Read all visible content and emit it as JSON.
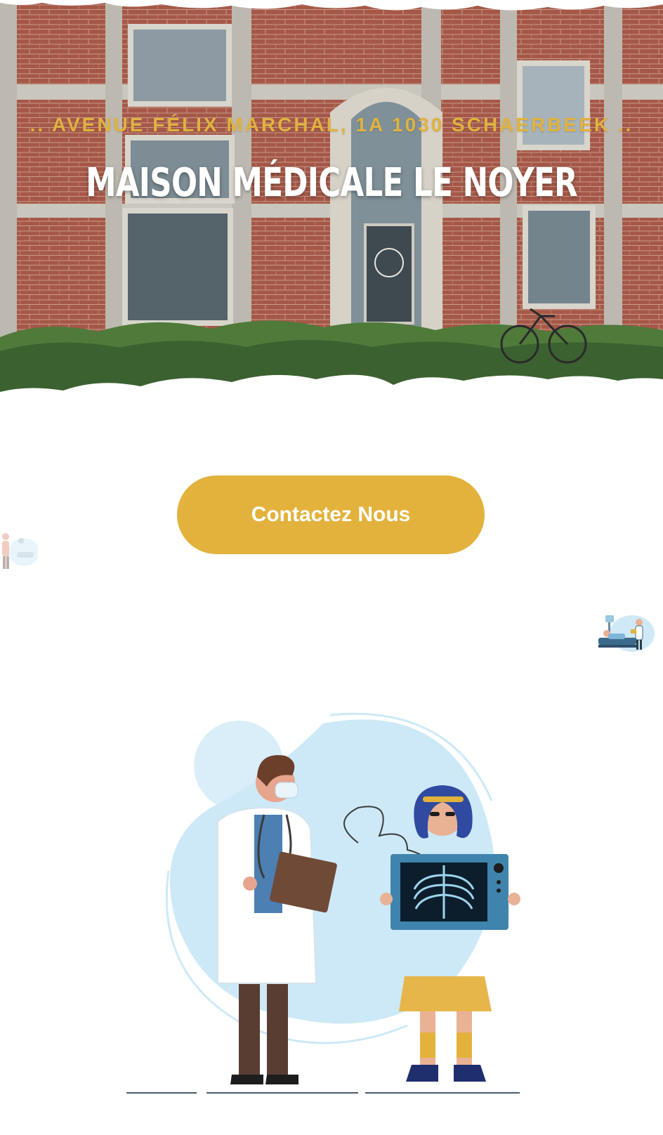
{
  "hero": {
    "address": ".. AVENUE FÉLIX MARCHAL, 1A 1030 SCHAERBEEK ..",
    "title": "MAISON MÉDICALE LE NOYER"
  },
  "cta": {
    "label": "Contactez Nous"
  },
  "icons": {
    "left_decoration": "doctor-scene-icon",
    "right_decoration": "hospital-bed-icon",
    "main_illustration": "doctor-xray-illustration"
  },
  "colors": {
    "accent": "#e3b23c",
    "address_text": "#e0b23f",
    "title_text": "#ffffff",
    "brick": "#a85a4a",
    "blob": "#cfe9f7"
  }
}
